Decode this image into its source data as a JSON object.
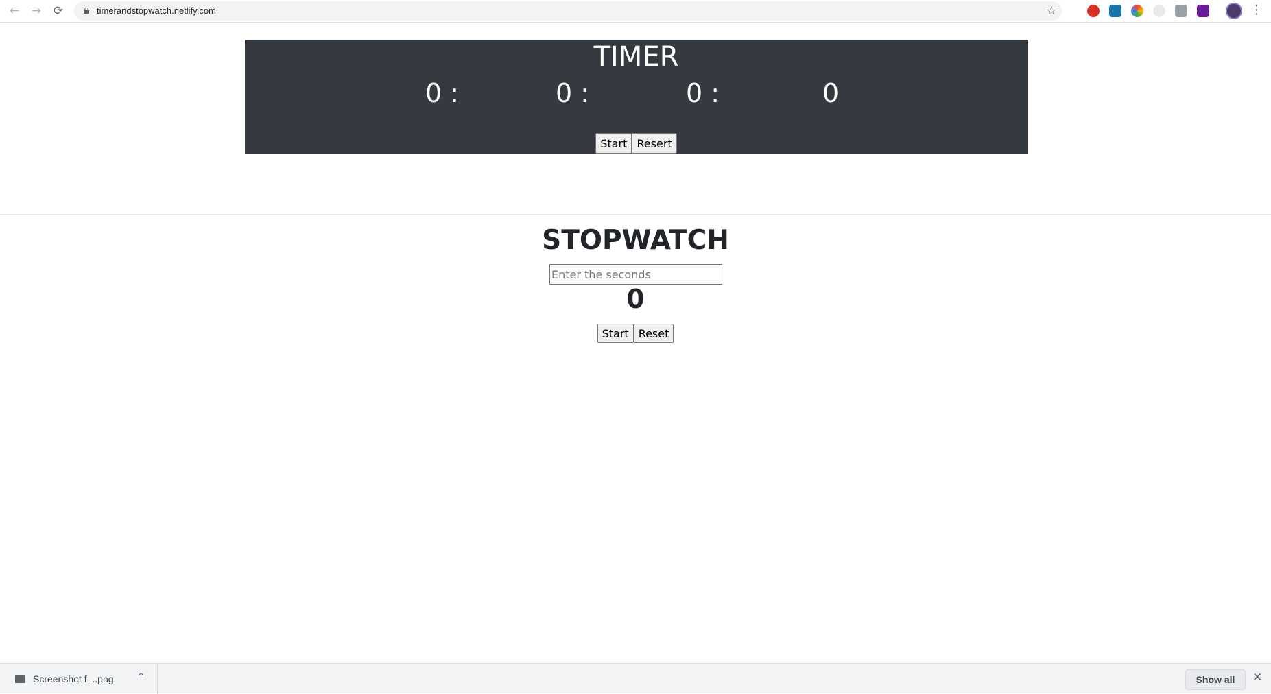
{
  "browser": {
    "url": "timerandstopwatch.netlify.com",
    "back_icon": "←",
    "forward_icon": "→",
    "reload_icon": "⟳",
    "star_icon": "☆",
    "menu_icon": "⋮"
  },
  "timer": {
    "title": "TIMER",
    "hours": "0 :",
    "minutes": "0 :",
    "seconds": "0 :",
    "milliseconds": "0",
    "start_label": "Start",
    "reset_label": "Resert"
  },
  "stopwatch": {
    "title": "STOPWATCH",
    "input_placeholder": "Enter the seconds",
    "input_value": "",
    "count": "0",
    "start_label": "Start",
    "reset_label": "Reset"
  },
  "downloads": {
    "file_name": "Screenshot f....png",
    "chevron": "^",
    "show_all_label": "Show all",
    "close_icon": "✕"
  },
  "colors": {
    "timer_panel_bg": "#343a40",
    "timer_text": "#ffffff",
    "page_text": "#212529"
  }
}
